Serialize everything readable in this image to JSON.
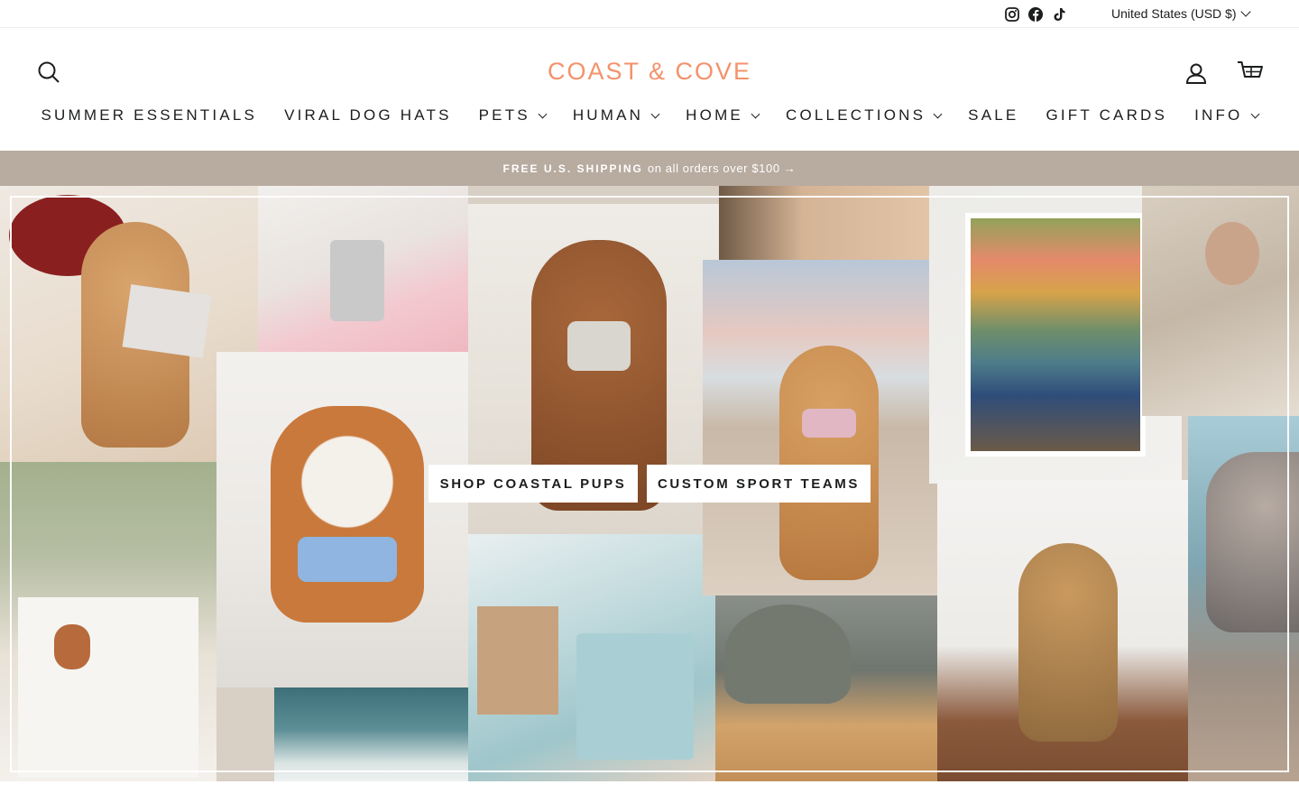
{
  "utility": {
    "social_icons": [
      "instagram-icon",
      "facebook-icon",
      "tiktok-icon"
    ],
    "currency": "United States (USD $)"
  },
  "header": {
    "logo": "COAST & COVE",
    "logo_color": "#f3926b",
    "icons": [
      "search-icon",
      "account-icon",
      "cart-icon"
    ]
  },
  "nav": [
    {
      "label": "SUMMER ESSENTIALS",
      "dropdown": false
    },
    {
      "label": "VIRAL DOG HATS",
      "dropdown": false
    },
    {
      "label": "PETS",
      "dropdown": true
    },
    {
      "label": "HUMAN",
      "dropdown": true
    },
    {
      "label": "HOME",
      "dropdown": true
    },
    {
      "label": "COLLECTIONS",
      "dropdown": true
    },
    {
      "label": "SALE",
      "dropdown": false
    },
    {
      "label": "GIFT CARDS",
      "dropdown": false
    },
    {
      "label": "INFO",
      "dropdown": true
    }
  ],
  "announcement": {
    "bold": "FREE U.S. SHIPPING",
    "text": "on all orders over $100 →",
    "background": "#b8aba0"
  },
  "hero": {
    "buttons": {
      "pups": "SHOP COASTAL PUPS",
      "teams": "CUSTOM SPORT TEAMS"
    }
  }
}
